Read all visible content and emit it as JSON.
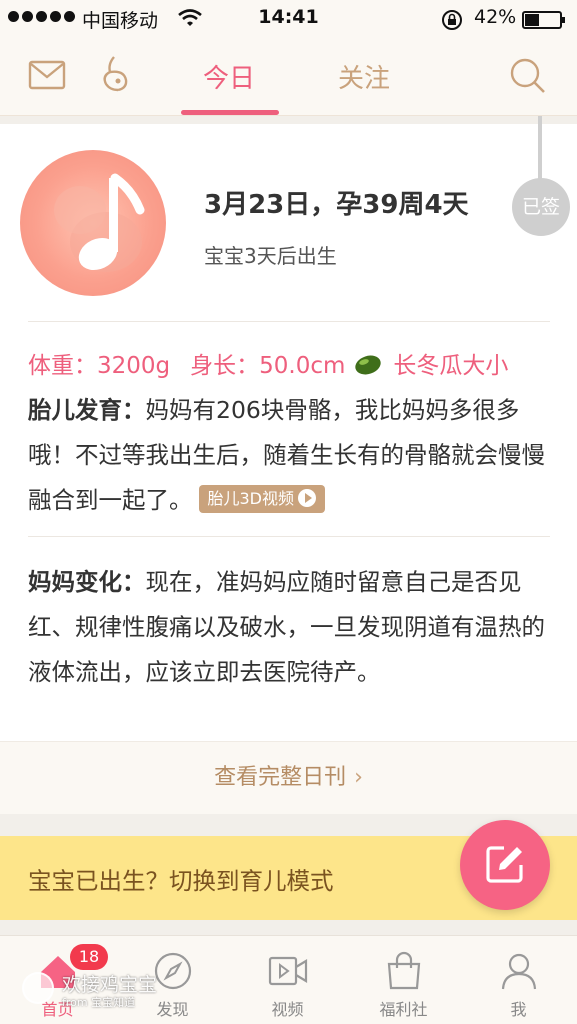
{
  "status_bar": {
    "carrier": "中国移动",
    "time": "14:41",
    "battery_percent": "42%",
    "battery_level": 0.42,
    "icons": [
      "signal-dots-icon",
      "wifi-icon",
      "rotation-lock-icon",
      "battery-icon"
    ]
  },
  "top_nav": {
    "tabs": [
      {
        "label": "今日",
        "active": true
      },
      {
        "label": "关注",
        "active": false
      }
    ],
    "icons": [
      "mail-icon",
      "pregnant-mom-icon",
      "search-icon"
    ]
  },
  "today": {
    "date_line": "3月23日，孕39周4天",
    "born_in": "宝宝3天后出生",
    "signed_label": "已签",
    "weight": "体重：3200g",
    "length": "身长：50.0cm",
    "size_compare": "长冬瓜大小",
    "fetal": {
      "lead": "胎儿发育：",
      "text": "妈妈有206块骨骼，我比妈妈多很多哦！不过等我出生后，随着生长有的骨骼就会慢慢融合到一起了。",
      "video_label": "胎儿3D视频"
    },
    "mom": {
      "lead": "妈妈变化：",
      "text": "现在，准妈妈应随时留意自己是否见红、规律性腹痛以及破水，一旦发现阴道有温热的液体流出，应该立即去医院待产。"
    },
    "full_issue": "查看完整日刊",
    "full_issue_chevron": "›"
  },
  "banner": {
    "text": "宝宝已出生？切换到育儿模式",
    "chevron": "›"
  },
  "tab_bar": {
    "items": [
      {
        "label": "首页",
        "icon": "home-icon",
        "active": true
      },
      {
        "label": "发现",
        "icon": "compass-icon",
        "active": false
      },
      {
        "label": "视频",
        "icon": "video-icon",
        "active": false
      },
      {
        "label": "福利社",
        "icon": "shopping-bag-icon",
        "active": false
      },
      {
        "label": "我",
        "icon": "person-icon",
        "active": false
      }
    ],
    "home_badge": "18"
  },
  "watermark": {
    "line1": "欢接鸡宝宝",
    "line2": "from 宝宝知道"
  },
  "colors": {
    "accent": "#ee5f7d",
    "gold": "#c9a27c",
    "banner": "#fde58a",
    "fab": "#f66384"
  }
}
